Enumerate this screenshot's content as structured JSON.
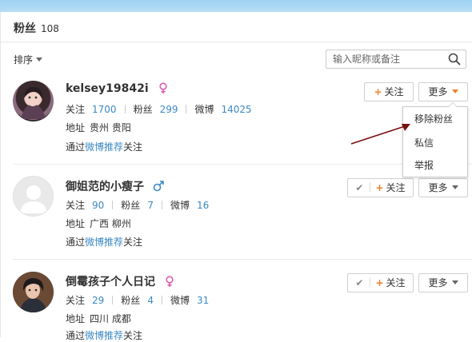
{
  "header": {
    "title": "粉丝",
    "count": "108"
  },
  "toolbar": {
    "sort_label": "排序"
  },
  "search": {
    "placeholder": "输入昵称或备注"
  },
  "labels": {
    "follow": "关注",
    "fans": "粉丝",
    "weibo": "微博",
    "address": "地址",
    "via_prefix": "通过",
    "via_link": "微博推荐",
    "via_suffix": "关注",
    "follow_button": "关注",
    "more_button": "更多"
  },
  "users": [
    {
      "name": "kelsey19842i",
      "gender": "female",
      "follow": "1700",
      "fans": "299",
      "weibo": "14025",
      "address": "贵州 贵阳"
    },
    {
      "name": "御姐范的小瘦子",
      "gender": "male",
      "follow": "90",
      "fans": "7",
      "weibo": "16",
      "address": "广西 柳州"
    },
    {
      "name": "倒霉孩子个人日记",
      "gender": "female",
      "follow": "29",
      "fans": "4",
      "weibo": "31",
      "address": "四川 成都"
    }
  ],
  "menu": {
    "items": [
      "移除粉丝",
      "私信",
      "举报"
    ]
  },
  "colors": {
    "link": "#3c89c3",
    "accent": "#f27f27",
    "female": "#e05bb1",
    "male": "#3c89c3",
    "arrow": "#7a0d0d"
  }
}
